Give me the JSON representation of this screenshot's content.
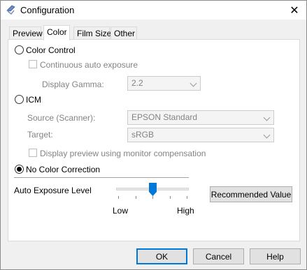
{
  "window": {
    "title": "Configuration",
    "close_symbol": "✕"
  },
  "tabs": [
    {
      "label": "Preview",
      "active": false
    },
    {
      "label": "Color",
      "active": true
    },
    {
      "label": "Film Size",
      "active": false
    },
    {
      "label": "Other",
      "active": false
    }
  ],
  "color_tab": {
    "color_control": {
      "label": "Color Control",
      "selected": false
    },
    "continuous_auto_exposure": {
      "label": "Continuous auto exposure",
      "checked": false,
      "enabled": false
    },
    "display_gamma": {
      "label": "Display Gamma:",
      "value": "2.2",
      "enabled": false
    },
    "icm": {
      "label": "ICM",
      "selected": false
    },
    "source_scanner": {
      "label": "Source (Scanner):",
      "value": "EPSON Standard",
      "enabled": false
    },
    "target": {
      "label": "Target:",
      "value": "sRGB",
      "enabled": false
    },
    "display_preview_compensation": {
      "label": "Display preview using monitor compensation",
      "checked": false,
      "enabled": false
    },
    "no_color_correction": {
      "label": "No Color Correction",
      "selected": true
    },
    "auto_exposure_level": {
      "label": "Auto Exposure Level",
      "low_label": "Low",
      "high_label": "High",
      "level_fraction": 0.5
    },
    "recommended_value_button": "Recommended Value"
  },
  "buttons": {
    "ok": "OK",
    "cancel": "Cancel",
    "help": "Help"
  },
  "colors": {
    "default_button_border": "#0078d7",
    "slider_thumb": "#0078d7",
    "disabled_text": "#838383"
  },
  "icons": {
    "app": "epson-scan-icon",
    "close": "close-icon",
    "dropdown": "chevron-down-icon"
  }
}
